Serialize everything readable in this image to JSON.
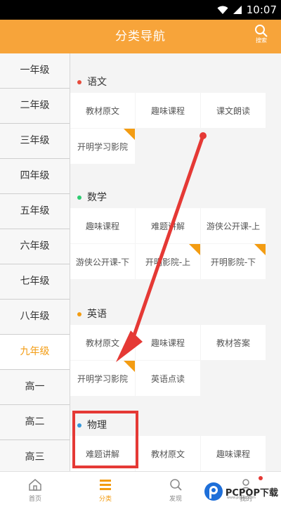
{
  "status_bar": {
    "time": "10:07"
  },
  "header": {
    "title": "分类导航",
    "search_label": "搜索"
  },
  "sidebar": {
    "items": [
      "一年级",
      "二年级",
      "三年级",
      "四年级",
      "五年级",
      "六年级",
      "七年级",
      "八年级",
      "九年级",
      "高一",
      "高二",
      "高三"
    ],
    "active": "九年级"
  },
  "sections": [
    {
      "name": "语文",
      "dot_color": "#e74c3c",
      "items": [
        {
          "label": "教材原文",
          "tag": false
        },
        {
          "label": "趣味课程",
          "tag": false
        },
        {
          "label": "课文朗读",
          "tag": false
        },
        {
          "label": "开明学习影院",
          "tag": true
        }
      ]
    },
    {
      "name": "数学",
      "dot_color": "#2ecc71",
      "items": [
        {
          "label": "趣味课程",
          "tag": false
        },
        {
          "label": "难题讲解",
          "tag": false
        },
        {
          "label": "游侠公开课-上",
          "tag": false
        },
        {
          "label": "游侠公开课-下",
          "tag": false
        },
        {
          "label": "开明影院-上",
          "tag": true
        },
        {
          "label": "开明影院-下",
          "tag": true
        }
      ]
    },
    {
      "name": "英语",
      "dot_color": "#f39c12",
      "items": [
        {
          "label": "教材原文",
          "tag": false
        },
        {
          "label": "趣味课程",
          "tag": false
        },
        {
          "label": "教材答案",
          "tag": false
        },
        {
          "label": "开明学习影院",
          "tag": true
        },
        {
          "label": "英语点读",
          "tag": false
        }
      ]
    },
    {
      "name": "物理",
      "dot_color": "#3498db",
      "items": [
        {
          "label": "难题讲解",
          "tag": false
        },
        {
          "label": "教材原文",
          "tag": false
        },
        {
          "label": "趣味课程",
          "tag": false
        }
      ]
    }
  ],
  "tabbar": {
    "items": [
      {
        "label": "首页",
        "icon": "home-icon"
      },
      {
        "label": "分类",
        "icon": "category-icon"
      },
      {
        "label": "发现",
        "icon": "discover-icon"
      },
      {
        "label": "我的",
        "icon": "profile-icon"
      }
    ],
    "active": "分类"
  },
  "watermark": {
    "text": "PCPOP下载",
    "sub": "www.pcpop.com"
  },
  "colors": {
    "accent": "#f7a43a",
    "annotation_red": "#e53935"
  }
}
